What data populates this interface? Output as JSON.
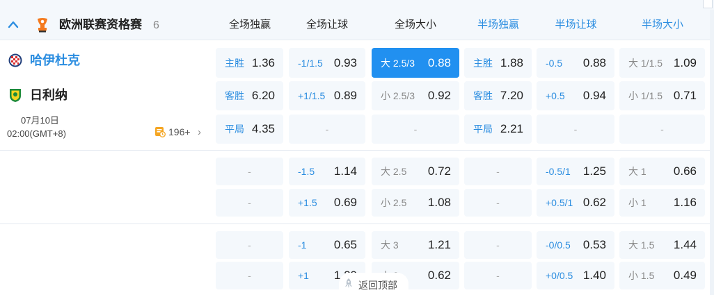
{
  "header": {
    "league_name": "欧洲联赛资格赛",
    "match_count": "6",
    "columns": [
      "全场独赢",
      "全场让球",
      "全场大小",
      "半场独赢",
      "半场让球",
      "半场大小"
    ]
  },
  "match": {
    "home_team": "哈伊杜克",
    "away_team": "日利纳",
    "date": "07月10日",
    "time": "02:00(GMT+8)",
    "more_count": "196+"
  },
  "odds_rows": [
    [
      {
        "label": "主胜",
        "value": "1.36"
      },
      {
        "label": "-1/1.5",
        "value": "0.93"
      },
      {
        "label": "大 2.5/3",
        "value": "0.88",
        "selected": true
      },
      {
        "label": "主胜",
        "value": "1.88"
      },
      {
        "label": "-0.5",
        "value": "0.88"
      },
      {
        "label": "大 1/1.5",
        "value": "1.09"
      }
    ],
    [
      {
        "label": "客胜",
        "value": "6.20"
      },
      {
        "label": "+1/1.5",
        "value": "0.89"
      },
      {
        "label": "小 2.5/3",
        "value": "0.92"
      },
      {
        "label": "客胜",
        "value": "7.20"
      },
      {
        "label": "+0.5",
        "value": "0.94"
      },
      {
        "label": "小 1/1.5",
        "value": "0.71"
      }
    ],
    [
      {
        "label": "平局",
        "value": "4.35"
      },
      {
        "empty": "-"
      },
      {
        "empty": "-"
      },
      {
        "label": "平局",
        "value": "2.21"
      },
      {
        "empty": "-"
      },
      {
        "empty": "-"
      }
    ],
    [
      {
        "empty": "-"
      },
      {
        "label": "-1.5",
        "value": "1.14"
      },
      {
        "label": "大 2.5",
        "value": "0.72"
      },
      {
        "empty": "-"
      },
      {
        "label": "-0.5/1",
        "value": "1.25"
      },
      {
        "label": "大 1",
        "value": "0.66"
      }
    ],
    [
      {
        "empty": "-"
      },
      {
        "label": "+1.5",
        "value": "0.69"
      },
      {
        "label": "小 2.5",
        "value": "1.08"
      },
      {
        "empty": "-"
      },
      {
        "label": "+0.5/1",
        "value": "0.62"
      },
      {
        "label": "小 1",
        "value": "1.16"
      }
    ],
    [
      {
        "empty": "-"
      },
      {
        "label": "-1",
        "value": "0.65"
      },
      {
        "label": "大 3",
        "value": "1.21"
      },
      {
        "empty": "-"
      },
      {
        "label": "-0/0.5",
        "value": "0.53"
      },
      {
        "label": "大 1.5",
        "value": "1.44"
      }
    ],
    [
      {
        "empty": "-"
      },
      {
        "label": "+1",
        "value": "1.29"
      },
      {
        "label": "小 3",
        "value": "0.62"
      },
      {
        "empty": "-"
      },
      {
        "label": "+0/0.5",
        "value": "1.40"
      },
      {
        "label": "小 1.5",
        "value": "0.49"
      }
    ]
  ],
  "back_to_top": "返回顶部",
  "colors": {
    "accent": "#2b8de0",
    "selected_bg": "#2190f0",
    "cell_bg": "#f4f8fc",
    "header_bg": "#f4f8fc"
  },
  "icons": {
    "collapse": "chevron-up-icon",
    "league": "europa-league-logo-icon",
    "home": "hajduk-crest-icon",
    "away": "zilina-crest-icon",
    "more": "stats-icon",
    "more_arrow": "chevron-right-icon",
    "back_to_top": "rocket-icon"
  }
}
